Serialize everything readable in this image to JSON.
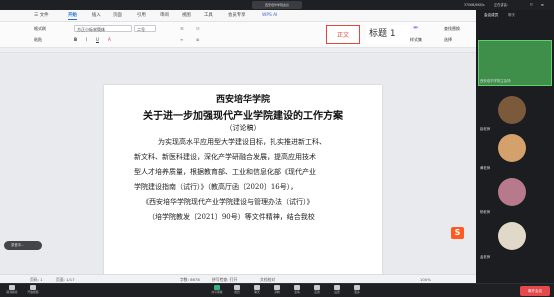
{
  "meeting": {
    "title": "西安培华学院会议"
  },
  "top_right": {
    "network": "370KB/6KB/s",
    "speaker": "正在讲话：",
    "grid": "☷",
    "layout": "⊞"
  },
  "wps": {
    "file_menu": "三 文件",
    "tabs": [
      "开始",
      "插入",
      "页面",
      "引用",
      "审阅",
      "视图",
      "工具",
      "会员专享",
      "WPS AI"
    ],
    "active_tab": "开始",
    "ribbon": {
      "paste": "格式刷",
      "paste2": "粘贴",
      "font": "方正小标宋简体",
      "size": "二号",
      "style_body": "正文",
      "style_title": "标题 1",
      "find": "查找替换",
      "select": "选择",
      "style_brush": "样式集"
    }
  },
  "document": {
    "school": "西安培华学院",
    "title": "关于进一步加强现代产业学院建设的工作方案",
    "subtitle": "（讨论稿）",
    "lines": [
      "为实现高水平应用型大学建设目标，扎实推进新工科、",
      "新文科、新医科建设，深化产学研融合发展，提高应用技术",
      "型人才培养质量，根据教育部、工业和信息化部《现代产业",
      "学院建设指南（试行）》（教高厅函〔2020〕16号），",
      "《西安培华学院现代产业学院建设与管理办法（试行）》",
      "（培学院教发〔2021〕90号）等文件精神，结合我校"
    ]
  },
  "status": {
    "page": "页码: 1",
    "pages": "页面: 1/17",
    "words": "字数: 8678",
    "spell": "拼写检查: 打开",
    "doc_check": "文档校对",
    "zoom": "100%"
  },
  "toast": "录音中...",
  "wps_icon": "S",
  "panel": {
    "tabs": [
      "会议成员",
      "聊天"
    ],
    "participants": [
      {
        "name": "西安培华学院主会场",
        "avatar_color": "#3f8f4a"
      },
      {
        "name": "赵老师",
        "avatar_color": "#7a5a3a"
      },
      {
        "name": "黄老师",
        "avatar_color": "#d4a06b"
      },
      {
        "name": "杨老师",
        "avatar_color": "#b67a8c"
      },
      {
        "name": "孟老师",
        "avatar_color": "#e0d8c8"
      }
    ]
  },
  "bottom": {
    "left": [
      "取消静音",
      "开启视频"
    ],
    "center": [
      "共享屏幕",
      "成员",
      "聊天",
      "录制",
      "表情",
      "应用",
      "设置",
      "更多"
    ],
    "leave": "离开会议"
  }
}
